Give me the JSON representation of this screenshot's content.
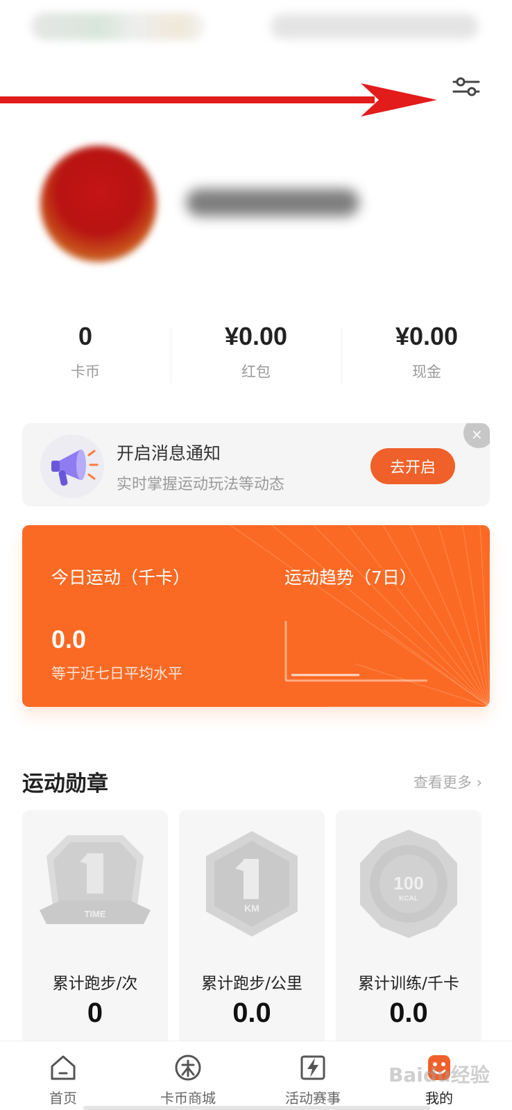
{
  "header": {
    "settings_icon": "sliders-icon",
    "annotation_arrow_color": "#e21b1b"
  },
  "profile": {
    "avatar": "avatar-blurred",
    "username": ""
  },
  "stats": [
    {
      "value": "0",
      "label": "卡币"
    },
    {
      "value": "¥0.00",
      "label": "红包"
    },
    {
      "value": "¥0.00",
      "label": "现金"
    }
  ],
  "notice": {
    "icon": "megaphone-icon",
    "title": "开启消息通知",
    "subtitle": "实时掌握运动玩法等动态",
    "button_label": "去开启",
    "close_label": "×"
  },
  "activity": {
    "today_title": "今日运动（千卡）",
    "today_value": "0.0",
    "today_note": "等于近七日平均水平",
    "trend_title": "运动趋势（7日）",
    "accent_color": "#fb6a24"
  },
  "medals": {
    "title": "运动勋章",
    "more_label": "查看更多 ›",
    "items": [
      {
        "icon": "medal-1-time-icon",
        "label": "累计跑步/次",
        "value": "0"
      },
      {
        "icon": "medal-1-km-icon",
        "label": "累计跑步/公里",
        "value": "0.0"
      },
      {
        "icon": "medal-100-kcal-icon",
        "label": "累计训练/千卡",
        "value": "0.0"
      }
    ]
  },
  "tabbar": {
    "items": [
      {
        "icon": "home-icon",
        "label": "首页"
      },
      {
        "icon": "coin-store-icon",
        "label": "卡币商城"
      },
      {
        "icon": "event-icon",
        "label": "活动赛事"
      },
      {
        "icon": "profile-icon",
        "label": "我的"
      }
    ],
    "active_color": "#f0602a"
  },
  "watermark": "Baidu经验"
}
